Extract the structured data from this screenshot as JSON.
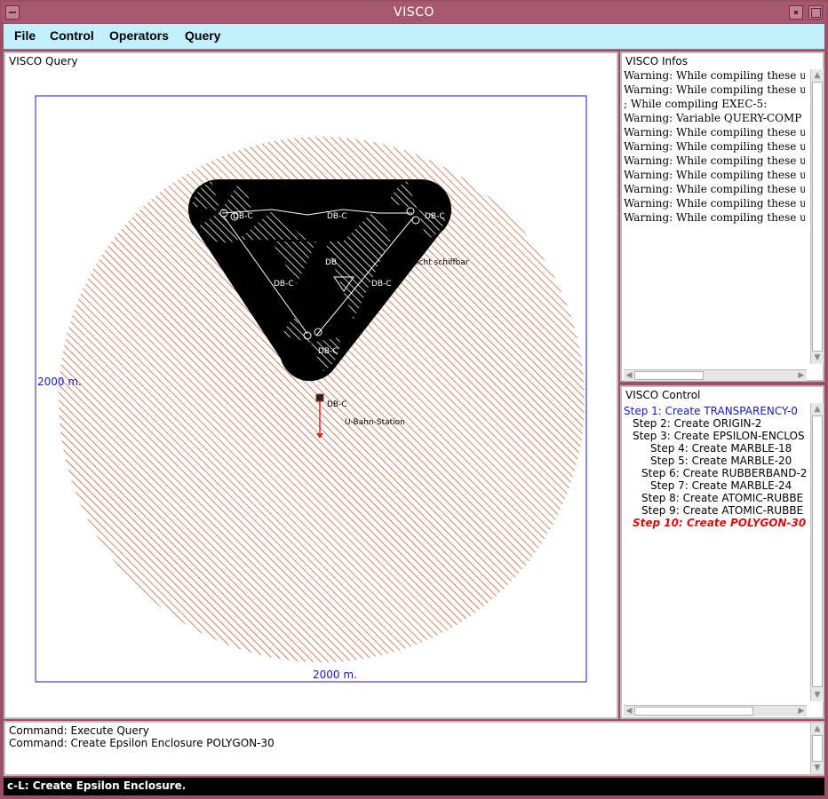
{
  "window": {
    "title": "VISCO"
  },
  "menu": [
    "File",
    "Control",
    "Operators",
    "Query"
  ],
  "query_panel": {
    "title": "VISCO Query",
    "scale_left": "2000 m.",
    "scale_bottom": "2000 m.",
    "labels": {
      "db_c_1": "DB-C",
      "db_c_2": "DB-C",
      "db_c_3": "DB-C",
      "db_c_4": "DB-C",
      "db_c_5": "DB-C",
      "db_c_6": "DB-C",
      "db_c_7": "DB-C",
      "db": "DB",
      "teilnicht": "Teil nicht schiffbar",
      "ubahn": "U-Bahn-Station"
    }
  },
  "info_panel": {
    "title": "VISCO Infos",
    "lines": [
      "Warning: While compiling these ur",
      "Warning: While compiling these ur",
      "; While compiling EXEC-5:",
      "Warning: Variable QUERY-COMP",
      "Warning: While compiling these ur",
      "Warning: While compiling these ur",
      "Warning: While compiling these ur",
      "Warning: While compiling these ur",
      "Warning: While compiling these ur",
      "Warning: While compiling these ur",
      "Warning: While compiling these ur"
    ]
  },
  "control_panel": {
    "title": "VISCO Control",
    "steps": [
      {
        "label": "Step 1: Create TRANSPARENCY-0",
        "indent": 0,
        "style": "active"
      },
      {
        "label": "Step 2: Create ORIGIN-2",
        "indent": 1,
        "style": "normal"
      },
      {
        "label": "Step 3: Create EPSILON-ENCLOS",
        "indent": 1,
        "style": "normal"
      },
      {
        "label": "Step 4: Create MARBLE-18",
        "indent": 3,
        "style": "normal"
      },
      {
        "label": "Step 5: Create MARBLE-20",
        "indent": 3,
        "style": "normal"
      },
      {
        "label": "Step 6: Create RUBBERBAND-2",
        "indent": 2,
        "style": "normal"
      },
      {
        "label": "Step 7: Create MARBLE-24",
        "indent": 3,
        "style": "normal"
      },
      {
        "label": "Step 8: Create ATOMIC-RUBBE",
        "indent": 2,
        "style": "normal"
      },
      {
        "label": "Step 9: Create ATOMIC-RUBBE",
        "indent": 2,
        "style": "normal"
      },
      {
        "label": "Step 10: Create POLYGON-30",
        "indent": 1,
        "style": "current"
      }
    ]
  },
  "command_panel": {
    "lines": [
      "Command: Execute Query",
      "Command: Create Epsilon Enclosure POLYGON-30"
    ]
  },
  "status": "c-L: Create Epsilon Enclosure.",
  "colors": {
    "titlebar": "#a6586e",
    "menubar": "#c3eefc",
    "blue_text": "#1a1aaa",
    "red_step": "#cc1111",
    "hatch": "#b0522a"
  }
}
